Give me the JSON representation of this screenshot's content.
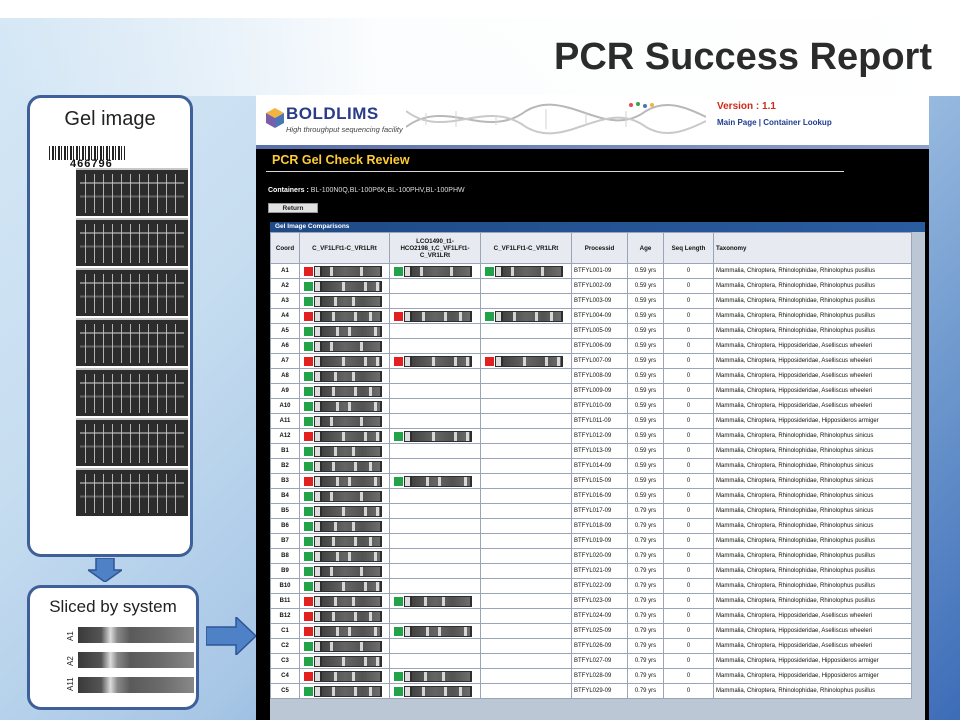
{
  "slide": {
    "title": "PCR Success Report"
  },
  "gel_panel": {
    "title": "Gel image",
    "barcode_number": "466796"
  },
  "sliced_panel": {
    "title": "Sliced by system",
    "lanes": [
      "A1",
      "A2",
      "A11"
    ]
  },
  "app": {
    "logo_name": "BOLDLIMS",
    "logo_subtitle": "High throughput sequencing facility",
    "version": "Version : 1.1",
    "nav": {
      "main_page": "Main Page",
      "separator": " | ",
      "container_lookup": "Container Lookup"
    },
    "page_title": "PCR Gel Check Review",
    "containers_label": "Containers :",
    "containers_value": "BL-100N0Q,BL-100P6K,BL-100PHV,BL-100PHW",
    "return_button": "Return",
    "comparisons_title": "Gel Image Comparisons",
    "colors": {
      "pass": "#22a34a",
      "fail": "#e32020",
      "title_yellow": "#ffcc33",
      "version_red": "#d0281a"
    },
    "table": {
      "headers": [
        "Coord",
        "C_VF1LFt1-C_VR1LRt",
        "LCO1490_t1-HCO2198_t,C_VF1LFt1-C_VR1LRt",
        "C_VF1LFt1-C_VR1LRt",
        "Processid",
        "Age",
        "Seq Length",
        "Taxonomy"
      ],
      "rows": [
        {
          "coord": "A1",
          "g1": "fail",
          "g2": "pass",
          "g3": "pass",
          "processid": "BTFYL001-09",
          "age": "0.59 yrs",
          "seq": "0",
          "tax": "Mammalia, Chiroptera, Rhinolophidae, Rhinolophus pusillus"
        },
        {
          "coord": "A2",
          "g1": "pass",
          "g2": "",
          "g3": "",
          "processid": "BTFYL002-09",
          "age": "0.59 yrs",
          "seq": "0",
          "tax": "Mammalia, Chiroptera, Rhinolophidae, Rhinolophus pusillus"
        },
        {
          "coord": "A3",
          "g1": "pass",
          "g2": "",
          "g3": "",
          "processid": "BTFYL003-09",
          "age": "0.59 yrs",
          "seq": "0",
          "tax": "Mammalia, Chiroptera, Rhinolophidae, Rhinolophus pusillus"
        },
        {
          "coord": "A4",
          "g1": "fail",
          "g2": "fail",
          "g3": "pass",
          "processid": "BTFYL004-09",
          "age": "0.59 yrs",
          "seq": "0",
          "tax": "Mammalia, Chiroptera, Rhinolophidae, Rhinolophus pusillus"
        },
        {
          "coord": "A5",
          "g1": "pass",
          "g2": "",
          "g3": "",
          "processid": "BTFYL005-09",
          "age": "0.59 yrs",
          "seq": "0",
          "tax": "Mammalia, Chiroptera, Rhinolophidae, Rhinolophus pusillus"
        },
        {
          "coord": "A6",
          "g1": "pass",
          "g2": "",
          "g3": "",
          "processid": "BTFYL006-09",
          "age": "0.59 yrs",
          "seq": "0",
          "tax": "Mammalia, Chiroptera, Hipposideridae, Aselliscus wheeleri"
        },
        {
          "coord": "A7",
          "g1": "fail",
          "g2": "fail",
          "g3": "fail",
          "processid": "BTFYL007-09",
          "age": "0.59 yrs",
          "seq": "0",
          "tax": "Mammalia, Chiroptera, Hipposideridae, Aselliscus wheeleri"
        },
        {
          "coord": "A8",
          "g1": "pass",
          "g2": "",
          "g3": "",
          "processid": "BTFYL008-09",
          "age": "0.59 yrs",
          "seq": "0",
          "tax": "Mammalia, Chiroptera, Hipposideridae, Aselliscus wheeleri"
        },
        {
          "coord": "A9",
          "g1": "pass",
          "g2": "",
          "g3": "",
          "processid": "BTFYL009-09",
          "age": "0.59 yrs",
          "seq": "0",
          "tax": "Mammalia, Chiroptera, Hipposideridae, Aselliscus wheeleri"
        },
        {
          "coord": "A10",
          "g1": "pass",
          "g2": "",
          "g3": "",
          "processid": "BTFYL010-09",
          "age": "0.59 yrs",
          "seq": "0",
          "tax": "Mammalia, Chiroptera, Hipposideridae, Aselliscus wheeleri"
        },
        {
          "coord": "A11",
          "g1": "pass",
          "g2": "",
          "g3": "",
          "processid": "BTFYL011-09",
          "age": "0.59 yrs",
          "seq": "0",
          "tax": "Mammalia, Chiroptera, Hipposideridae, Hipposideros armiger"
        },
        {
          "coord": "A12",
          "g1": "fail",
          "g2": "pass",
          "g3": "",
          "processid": "BTFYL012-09",
          "age": "0.59 yrs",
          "seq": "0",
          "tax": "Mammalia, Chiroptera, Rhinolophidae, Rhinolophus sinicus"
        },
        {
          "coord": "B1",
          "g1": "pass",
          "g2": "",
          "g3": "",
          "processid": "BTFYL013-09",
          "age": "0.59 yrs",
          "seq": "0",
          "tax": "Mammalia, Chiroptera, Rhinolophidae, Rhinolophus sinicus"
        },
        {
          "coord": "B2",
          "g1": "pass",
          "g2": "",
          "g3": "",
          "processid": "BTFYL014-09",
          "age": "0.59 yrs",
          "seq": "0",
          "tax": "Mammalia, Chiroptera, Rhinolophidae, Rhinolophus sinicus"
        },
        {
          "coord": "B3",
          "g1": "fail",
          "g2": "pass",
          "g3": "",
          "processid": "BTFYL015-09",
          "age": "0.59 yrs",
          "seq": "0",
          "tax": "Mammalia, Chiroptera, Rhinolophidae, Rhinolophus sinicus"
        },
        {
          "coord": "B4",
          "g1": "pass",
          "g2": "",
          "g3": "",
          "processid": "BTFYL016-09",
          "age": "0.59 yrs",
          "seq": "0",
          "tax": "Mammalia, Chiroptera, Rhinolophidae, Rhinolophus sinicus"
        },
        {
          "coord": "B5",
          "g1": "pass",
          "g2": "",
          "g3": "",
          "processid": "BTFYL017-09",
          "age": "0.79 yrs",
          "seq": "0",
          "tax": "Mammalia, Chiroptera, Rhinolophidae, Rhinolophus sinicus"
        },
        {
          "coord": "B6",
          "g1": "pass",
          "g2": "",
          "g3": "",
          "processid": "BTFYL018-09",
          "age": "0.79 yrs",
          "seq": "0",
          "tax": "Mammalia, Chiroptera, Rhinolophidae, Rhinolophus sinicus"
        },
        {
          "coord": "B7",
          "g1": "pass",
          "g2": "",
          "g3": "",
          "processid": "BTFYL019-09",
          "age": "0.79 yrs",
          "seq": "0",
          "tax": "Mammalia, Chiroptera, Rhinolophidae, Rhinolophus pusillus"
        },
        {
          "coord": "B8",
          "g1": "pass",
          "g2": "",
          "g3": "",
          "processid": "BTFYL020-09",
          "age": "0.79 yrs",
          "seq": "0",
          "tax": "Mammalia, Chiroptera, Rhinolophidae, Rhinolophus pusillus"
        },
        {
          "coord": "B9",
          "g1": "pass",
          "g2": "",
          "g3": "",
          "processid": "BTFYL021-09",
          "age": "0.79 yrs",
          "seq": "0",
          "tax": "Mammalia, Chiroptera, Rhinolophidae, Rhinolophus pusillus"
        },
        {
          "coord": "B10",
          "g1": "pass",
          "g2": "",
          "g3": "",
          "processid": "BTFYL022-09",
          "age": "0.79 yrs",
          "seq": "0",
          "tax": "Mammalia, Chiroptera, Rhinolophidae, Rhinolophus pusillus"
        },
        {
          "coord": "B11",
          "g1": "fail",
          "g2": "pass",
          "g3": "",
          "processid": "BTFYL023-09",
          "age": "0.79 yrs",
          "seq": "0",
          "tax": "Mammalia, Chiroptera, Rhinolophidae, Rhinolophus pusillus"
        },
        {
          "coord": "B12",
          "g1": "fail",
          "g2": "",
          "g3": "",
          "processid": "BTFYL024-09",
          "age": "0.79 yrs",
          "seq": "0",
          "tax": "Mammalia, Chiroptera, Hipposideridae, Aselliscus wheeleri"
        },
        {
          "coord": "C1",
          "g1": "fail",
          "g2": "pass",
          "g3": "",
          "processid": "BTFYL025-09",
          "age": "0.79 yrs",
          "seq": "0",
          "tax": "Mammalia, Chiroptera, Hipposideridae, Aselliscus wheeleri"
        },
        {
          "coord": "C2",
          "g1": "pass",
          "g2": "",
          "g3": "",
          "processid": "BTFYL026-09",
          "age": "0.79 yrs",
          "seq": "0",
          "tax": "Mammalia, Chiroptera, Hipposideridae, Aselliscus wheeleri"
        },
        {
          "coord": "C3",
          "g1": "pass",
          "g2": "",
          "g3": "",
          "processid": "BTFYL027-09",
          "age": "0.79 yrs",
          "seq": "0",
          "tax": "Mammalia, Chiroptera, Hipposideridae, Hipposideros armiger"
        },
        {
          "coord": "C4",
          "g1": "fail",
          "g2": "pass",
          "g3": "",
          "processid": "BTFYL028-09",
          "age": "0.79 yrs",
          "seq": "0",
          "tax": "Mammalia, Chiroptera, Hipposideridae, Hipposideros armiger"
        },
        {
          "coord": "C5",
          "g1": "pass",
          "g2": "pass",
          "g3": "",
          "processid": "BTFYL029-09",
          "age": "0.79 yrs",
          "seq": "0",
          "tax": "Mammalia, Chiroptera, Rhinolophidae, Rhinolophus pusillus"
        }
      ]
    }
  }
}
